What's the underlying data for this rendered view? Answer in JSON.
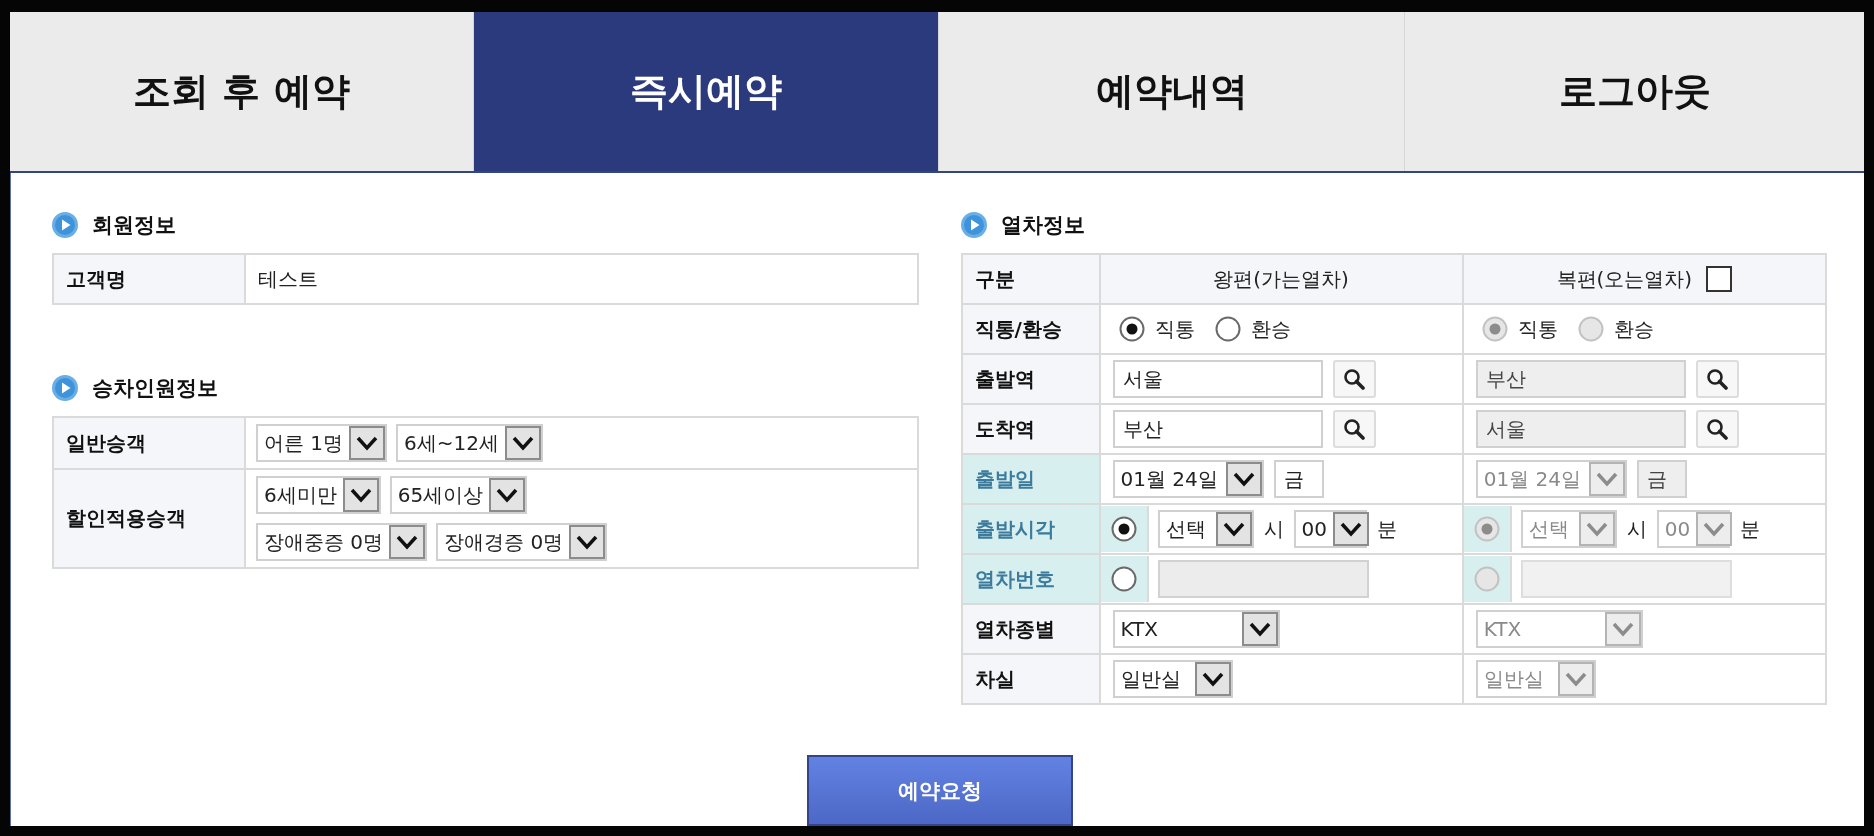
{
  "tabs": [
    {
      "label": "조회 후 예약",
      "selected": false
    },
    {
      "label": "즉시예약",
      "selected": true
    },
    {
      "label": "예약내역",
      "selected": false
    },
    {
      "label": "로그아웃",
      "selected": false
    }
  ],
  "member_info": {
    "title": "회원정보",
    "rows": [
      {
        "label": "고객명",
        "value": "테스트"
      }
    ]
  },
  "passenger_info": {
    "title": "승차인원정보",
    "rows": [
      {
        "label": "일반승객",
        "lines": [
          [
            "어른 1명",
            "6세~12세"
          ]
        ]
      },
      {
        "label": "할인적용승객",
        "lines": [
          [
            "6세미만",
            "65세이상"
          ],
          [
            "장애중증 0명",
            "장애경증 0명"
          ]
        ]
      }
    ]
  },
  "train_info": {
    "title": "열차정보",
    "header_label": "구분",
    "columns": [
      {
        "title": "왕편(가는열차)",
        "disabled": false
      },
      {
        "title": "복편(오는열차)",
        "checked": false,
        "disabled": true
      }
    ],
    "rows": [
      {
        "kind": "route",
        "label": "직통/환승",
        "highlighted": false,
        "cells": [
          {
            "options": [
              {
                "label": "직통",
                "selected": true
              },
              {
                "label": "환승",
                "selected": false
              }
            ]
          },
          {
            "options": [
              {
                "label": "직통",
                "selected": true
              },
              {
                "label": "환승",
                "selected": false
              }
            ]
          }
        ]
      },
      {
        "kind": "station",
        "label": "출발역",
        "highlighted": false,
        "cells": [
          {
            "value": "서울"
          },
          {
            "value": "부산"
          }
        ]
      },
      {
        "kind": "station",
        "label": "도착역",
        "highlighted": false,
        "cells": [
          {
            "value": "부산"
          },
          {
            "value": "서울"
          }
        ]
      },
      {
        "kind": "date",
        "label": "출발일",
        "highlighted": true,
        "cells": [
          {
            "date": "01월 24일",
            "weekday": "금"
          },
          {
            "date": "01월 24일",
            "weekday": "금"
          }
        ]
      },
      {
        "kind": "time",
        "label": "출발시각",
        "highlighted": true,
        "cells": [
          {
            "selected": true,
            "hour": "선택",
            "hour_unit": "시",
            "minute": "00",
            "minute_unit": "분"
          },
          {
            "selected": true,
            "hour": "선택",
            "hour_unit": "시",
            "minute": "00",
            "minute_unit": "분"
          }
        ]
      },
      {
        "kind": "train_number",
        "label": "열차번호",
        "highlighted": true,
        "cells": [
          {
            "selected": false
          },
          {
            "selected": false
          }
        ]
      },
      {
        "kind": "select",
        "label": "열차종별",
        "highlighted": false,
        "cells": [
          {
            "value": "KTX"
          },
          {
            "value": "KTX"
          }
        ]
      },
      {
        "kind": "select",
        "label": "차실",
        "highlighted": false,
        "cells": [
          {
            "value": "일반실"
          },
          {
            "value": "일반실"
          }
        ]
      }
    ]
  },
  "submit_button": "예약요청"
}
